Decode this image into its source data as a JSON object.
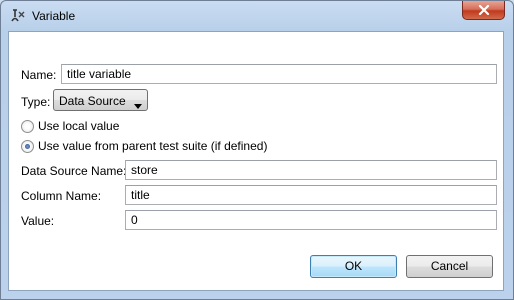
{
  "window": {
    "title": "Variable"
  },
  "form": {
    "name_label": "Name:",
    "name_value": "title variable",
    "type_label": "Type:",
    "type_value": "Data Source",
    "radio_local": "Use local value",
    "radio_parent": "Use value from parent test suite (if defined)",
    "radio_parent_checked": true,
    "ds_name_label": "Data Source Name:",
    "ds_name_value": "store",
    "column_label": "Column Name:",
    "column_value": "title",
    "value_label": "Value:",
    "value_value": "0"
  },
  "buttons": {
    "ok": "OK",
    "cancel": "Cancel"
  },
  "icons": {
    "app": "variable-icon",
    "close": "close-icon",
    "dropdown": "chevron-down-icon"
  }
}
